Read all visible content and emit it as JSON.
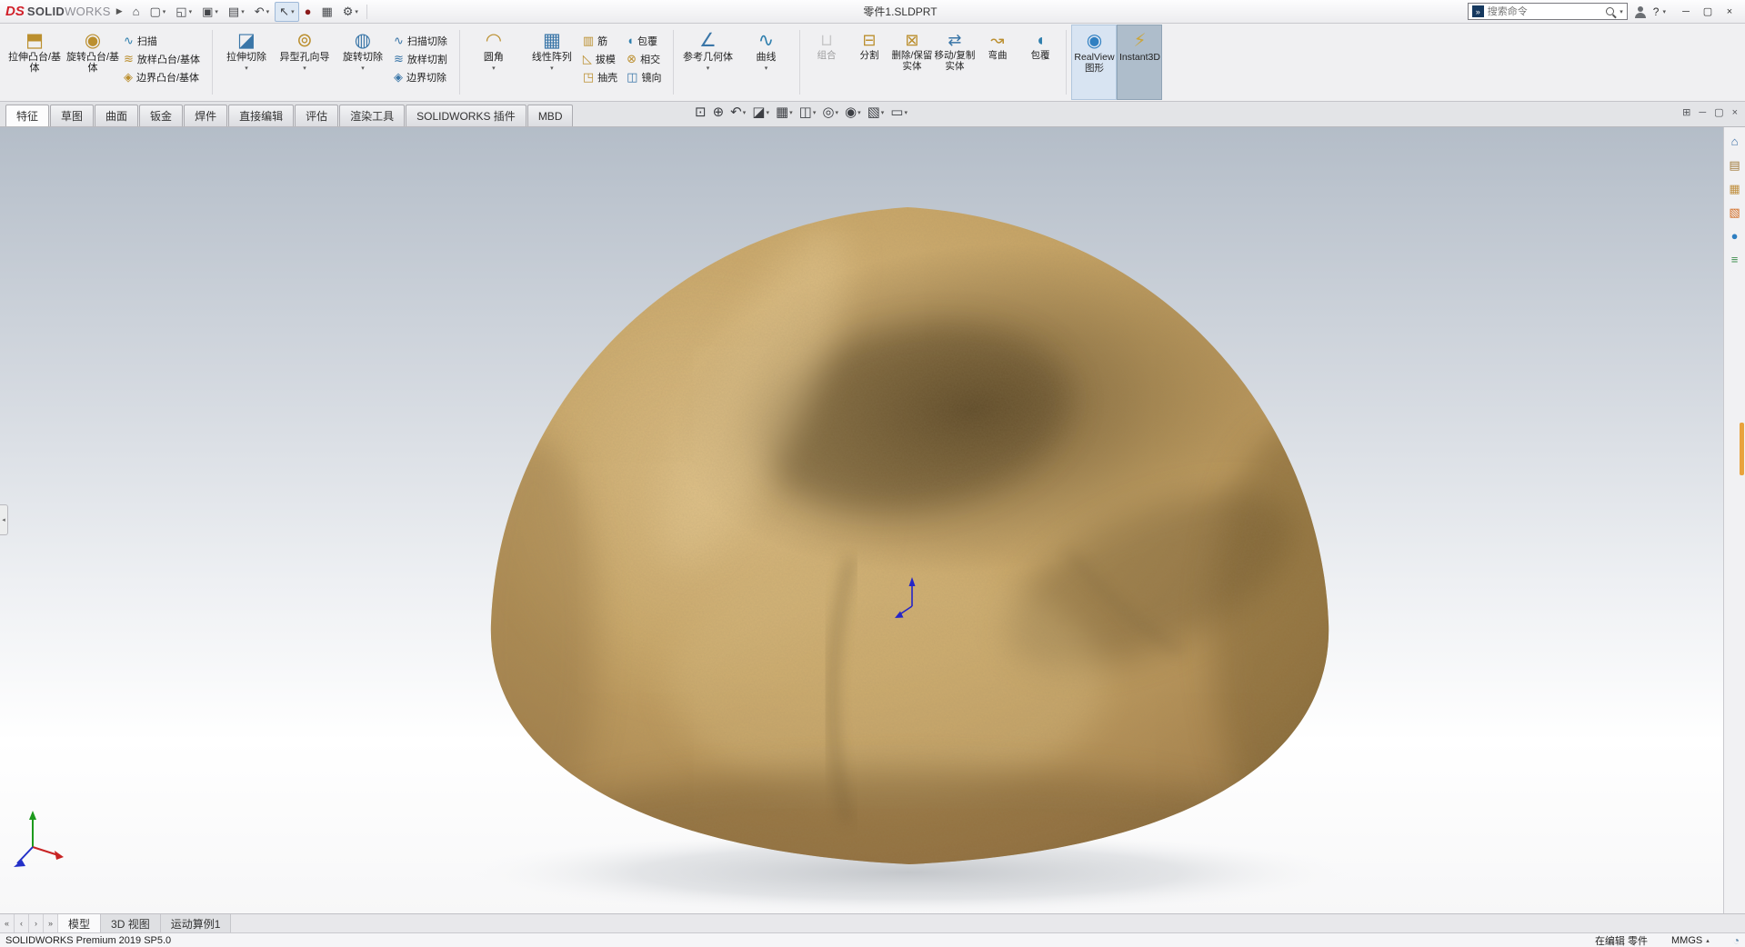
{
  "titlebar": {
    "logo_ds": "DS",
    "logo_solid": "SOLID",
    "logo_works": "WORKS",
    "document_title": "零件1.SLDPRT",
    "help_label": "?",
    "search": {
      "placeholder": "搜索命令"
    },
    "quick_access": [
      {
        "name": "home-button",
        "glyph": "⌂"
      },
      {
        "name": "new-document-button",
        "glyph": "▢",
        "caret": true
      },
      {
        "name": "open-document-button",
        "glyph": "◱",
        "caret": true
      },
      {
        "name": "save-button",
        "glyph": "▣",
        "caret": true
      },
      {
        "name": "print-button",
        "glyph": "▤",
        "caret": true
      },
      {
        "name": "undo-button",
        "glyph": "↶",
        "caret": true
      },
      {
        "name": "select-tool-button",
        "glyph": "↖",
        "caret": true,
        "active": true
      },
      {
        "name": "rebuild-button",
        "glyph": "●",
        "c": "#8b1a1a"
      },
      {
        "name": "options-grid-button",
        "glyph": "▦"
      },
      {
        "name": "settings-button",
        "glyph": "⚙",
        "caret": true
      }
    ],
    "window_controls": [
      {
        "name": "minimize-button",
        "glyph": "─"
      },
      {
        "name": "maximize-button",
        "glyph": "▢"
      },
      {
        "name": "close-button",
        "glyph": "×"
      }
    ]
  },
  "ribbon": {
    "boss_large": [
      {
        "name": "extruded-boss-base-button",
        "label": "拉伸凸台/基体",
        "glyph": "⬒",
        "c": "#bb8f2f"
      },
      {
        "name": "revolved-boss-base-button",
        "label": "旋转凸台/基体",
        "glyph": "◉",
        "c": "#bb8f2f"
      }
    ],
    "boss_small": [
      {
        "name": "swept-boss-base-button",
        "label": "扫描",
        "glyph": "∿",
        "c": "#2f7fae"
      },
      {
        "name": "lofted-boss-base-button",
        "label": "放样凸台/基体",
        "glyph": "≋",
        "c": "#bb8f2f"
      },
      {
        "name": "boundary-boss-base-button",
        "label": "边界凸台/基体",
        "glyph": "◈",
        "c": "#bb8f2f"
      }
    ],
    "cut_large": [
      {
        "name": "extruded-cut-button",
        "label": "拉伸切除",
        "glyph": "◪",
        "c": "#3a76a8",
        "caret": true
      },
      {
        "name": "hole-wizard-button",
        "label": "异型孔向导",
        "glyph": "⊚",
        "c": "#bb8f2f",
        "caret": true
      },
      {
        "name": "revolved-cut-button",
        "label": "旋转切除",
        "glyph": "◍",
        "c": "#3a76a8",
        "caret": true
      }
    ],
    "cut_small": [
      {
        "name": "swept-cut-button",
        "label": "扫描切除",
        "glyph": "∿",
        "c": "#3a76a8"
      },
      {
        "name": "lofted-cut-button",
        "label": "放样切割",
        "glyph": "≋",
        "c": "#3a76a8"
      },
      {
        "name": "boundary-cut-button",
        "label": "边界切除",
        "glyph": "◈",
        "c": "#3a76a8"
      }
    ],
    "feat_large": [
      {
        "name": "fillet-button",
        "label": "圆角",
        "glyph": "◠",
        "c": "#bb8f2f",
        "caret": true
      },
      {
        "name": "linear-pattern-button",
        "label": "线性阵列",
        "glyph": "▦",
        "c": "#3a76a8",
        "caret": true
      }
    ],
    "feat_small_a": [
      {
        "name": "rib-button",
        "label": "筋",
        "glyph": "▥",
        "c": "#bb8f2f"
      },
      {
        "name": "draft-button",
        "label": "拔模",
        "glyph": "◺",
        "c": "#bb8f2f"
      },
      {
        "name": "shell-button",
        "label": "抽壳",
        "glyph": "◳",
        "c": "#bb8f2f"
      }
    ],
    "feat_small_b": [
      {
        "name": "wrap-button",
        "label": "包覆",
        "glyph": "◖",
        "c": "#2f7fae"
      },
      {
        "name": "intersect-button",
        "label": "相交",
        "glyph": "⊗",
        "c": "#bb8f2f"
      },
      {
        "name": "mirror-button",
        "label": "镜向",
        "glyph": "◫",
        "c": "#3a76a8"
      }
    ],
    "ref_large": [
      {
        "name": "reference-geometry-button",
        "label": "参考几何体",
        "glyph": "∠",
        "c": "#3a76a8",
        "caret": true
      },
      {
        "name": "curves-button",
        "label": "曲线",
        "glyph": "∿",
        "c": "#2f7fae",
        "caret": true
      }
    ],
    "body_medium": [
      {
        "name": "combine-button",
        "label": "组合",
        "glyph": "⊔",
        "c": "#8a8f95",
        "disabled": true
      },
      {
        "name": "split-button",
        "label": "分割",
        "glyph": "⊟",
        "c": "#bb8f2f"
      },
      {
        "name": "delete-keep-body-button",
        "label": "删除/保留实体",
        "glyph": "⊠",
        "c": "#bb8f2f"
      },
      {
        "name": "move-copy-bodies-button",
        "label": "移动/复制实体",
        "glyph": "⇄",
        "c": "#3a76a8"
      },
      {
        "name": "flex-button",
        "label": "弯曲",
        "glyph": "↝",
        "c": "#bb8f2f"
      },
      {
        "name": "wrap-button-2",
        "label": "包覆",
        "glyph": "◖",
        "c": "#2f7fae"
      }
    ],
    "display_toggles": [
      {
        "name": "realview-graphics-toggle",
        "label": "RealView 图形",
        "glyph": "◉",
        "c": "#2f7fc1",
        "state": "active-light"
      },
      {
        "name": "instant3d-toggle",
        "label": "Instant3D",
        "glyph": "⚡",
        "c": "#caa53d",
        "state": "active-dark"
      }
    ]
  },
  "tabs": [
    {
      "name": "tab-features",
      "label": "特征",
      "active": true
    },
    {
      "name": "tab-sketch",
      "label": "草图"
    },
    {
      "name": "tab-surfaces",
      "label": "曲面"
    },
    {
      "name": "tab-sheet-metal",
      "label": "钣金"
    },
    {
      "name": "tab-weldments",
      "label": "焊件"
    },
    {
      "name": "tab-direct-editing",
      "label": "直接编辑"
    },
    {
      "name": "tab-evaluate",
      "label": "评估"
    },
    {
      "name": "tab-render-tools",
      "label": "渲染工具"
    },
    {
      "name": "tab-solidworks-addins",
      "label": "SOLIDWORKS 插件"
    },
    {
      "name": "tab-mbd",
      "label": "MBD"
    }
  ],
  "hud": [
    {
      "name": "zoom-to-fit-button",
      "glyph": "⊡"
    },
    {
      "name": "zoom-to-area-button",
      "glyph": "⊕"
    },
    {
      "name": "previous-view-button",
      "glyph": "↶",
      "caret": true
    },
    {
      "name": "section-view-button",
      "glyph": "◪",
      "caret": true
    },
    {
      "name": "view-orientation-button",
      "glyph": "▦",
      "caret": true
    },
    {
      "name": "display-style-button",
      "glyph": "◫",
      "caret": true
    },
    {
      "name": "hide-show-items-button",
      "glyph": "◎",
      "caret": true
    },
    {
      "name": "edit-appearance-button",
      "glyph": "◉",
      "caret": true
    },
    {
      "name": "apply-scene-button",
      "glyph": "▧",
      "caret": true
    },
    {
      "name": "view-settings-button",
      "glyph": "▭",
      "caret": true
    }
  ],
  "docwin_controls": [
    {
      "name": "doc-tile-button",
      "glyph": "⊞"
    },
    {
      "name": "doc-minimize-button",
      "glyph": "─"
    },
    {
      "name": "doc-restore-button",
      "glyph": "▢"
    },
    {
      "name": "doc-close-button",
      "glyph": "×"
    }
  ],
  "task_pane": [
    {
      "name": "taskpane-home-button",
      "glyph": "⌂",
      "c": "#3a6ea5"
    },
    {
      "name": "taskpane-design-library-button",
      "glyph": "▤",
      "c": "#a07a3a"
    },
    {
      "name": "taskpane-file-explorer-button",
      "glyph": "▦",
      "c": "#c09040"
    },
    {
      "name": "taskpane-view-palette-button",
      "glyph": "▧",
      "c": "#d2691e"
    },
    {
      "name": "taskpane-appearances-button",
      "glyph": "●",
      "c": "#2f7fc1"
    },
    {
      "name": "taskpane-custom-properties-button",
      "glyph": "≡",
      "c": "#3f8f4f"
    }
  ],
  "bottom": {
    "nav": [
      {
        "name": "scroll-first-button",
        "glyph": "«"
      },
      {
        "name": "scroll-prev-button",
        "glyph": "‹"
      },
      {
        "name": "scroll-next-button",
        "glyph": "›"
      },
      {
        "name": "scroll-last-button",
        "glyph": "»"
      }
    ],
    "tabs": [
      {
        "name": "tab-model",
        "label": "模型",
        "active": true
      },
      {
        "name": "tab-3d-views",
        "label": "3D 视图"
      },
      {
        "name": "tab-motion-study-1",
        "label": "运动算例1"
      }
    ]
  },
  "status_bar": {
    "left": "SOLIDWORKS Premium 2019 SP5.0",
    "editing": "在编辑 零件",
    "units": "MMGS"
  }
}
